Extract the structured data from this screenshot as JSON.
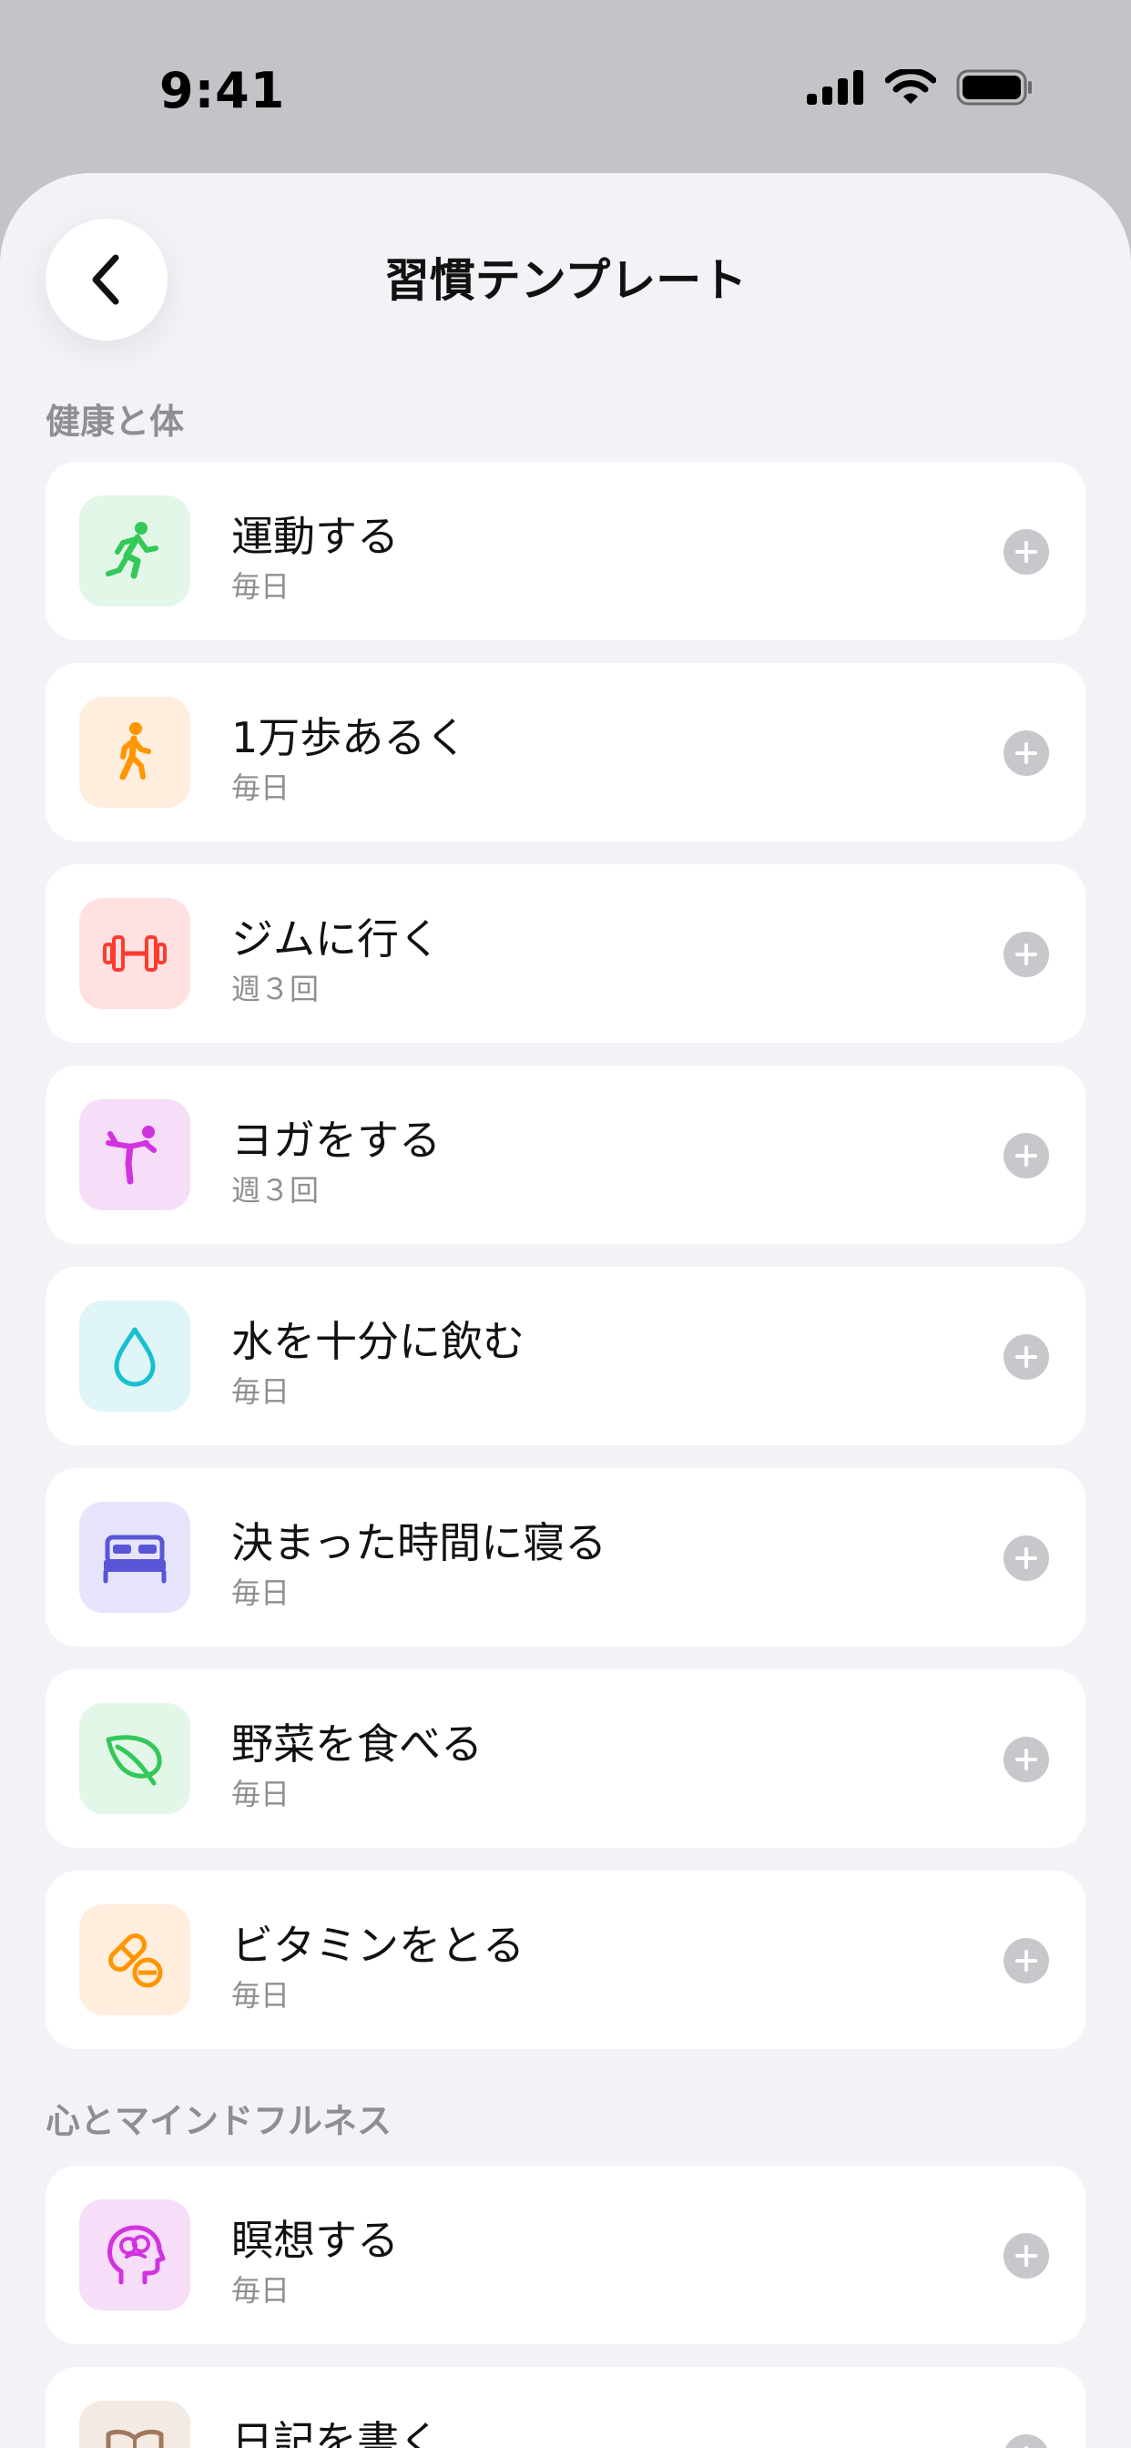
{
  "status": {
    "time": "9:41"
  },
  "header": {
    "title": "習慣テンプレート"
  },
  "sections": [
    {
      "title": "健康と体"
    },
    {
      "title": "心とマインドフルネス"
    }
  ],
  "items": [
    {
      "title": "運動する",
      "frequency": "毎日",
      "icon": "running-icon",
      "bg": "#e3f7e8",
      "color": "#34c759"
    },
    {
      "title": "1万歩あるく",
      "frequency": "毎日",
      "icon": "walking-icon",
      "bg": "#ffeedd",
      "color": "#ff9500"
    },
    {
      "title": "ジムに行く",
      "frequency": "週３回",
      "icon": "dumbbell-icon",
      "bg": "#ffe1e1",
      "color": "#ff3b30"
    },
    {
      "title": "ヨガをする",
      "frequency": "週３回",
      "icon": "yoga-icon",
      "bg": "#f6ddf8",
      "color": "#d133e0"
    },
    {
      "title": "水を十分に飲む",
      "frequency": "毎日",
      "icon": "water-drop-icon",
      "bg": "#dff5f8",
      "color": "#17c0d0"
    },
    {
      "title": "決まった時間に寝る",
      "frequency": "毎日",
      "icon": "bed-icon",
      "bg": "#e6e4fb",
      "color": "#5856d6"
    },
    {
      "title": "野菜を食べる",
      "frequency": "毎日",
      "icon": "leaf-icon",
      "bg": "#e3f7e8",
      "color": "#34c759"
    },
    {
      "title": "ビタミンをとる",
      "frequency": "毎日",
      "icon": "pills-icon",
      "bg": "#ffeedd",
      "color": "#ff9500"
    },
    {
      "title": "瞑想する",
      "frequency": "毎日",
      "icon": "brain-icon",
      "bg": "#f6ddf8",
      "color": "#d133e0"
    },
    {
      "title": "日記を書く",
      "frequency": "",
      "icon": "journal-icon",
      "bg": "#f3ebe3",
      "color": "#a2785c"
    }
  ]
}
